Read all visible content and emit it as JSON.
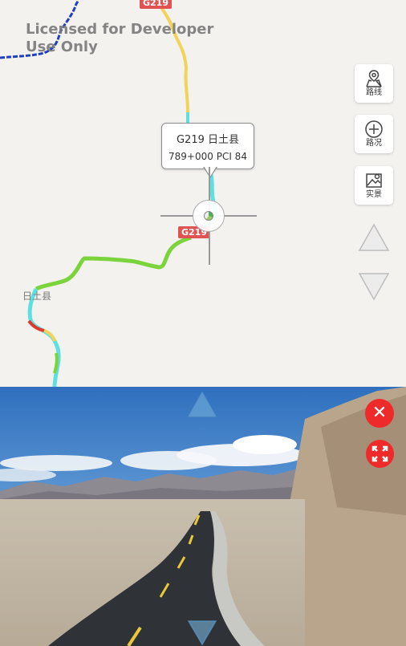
{
  "map": {
    "watermark": "Licensed for Developer Use Only",
    "road_shield_top": "G219",
    "road_shield_mid": "G219",
    "place_label": "日土县",
    "popup": {
      "line1": "G219 日土县",
      "line2": "789+000 PCI 84"
    },
    "buttons": {
      "route_label": "路线",
      "traffic_label": "路况",
      "scene_label": "实景"
    },
    "colors": {
      "route_blue": "#1f3fbf",
      "pci_good": "#7bd43c",
      "pci_cyan": "#5fe0e0",
      "pci_yellow": "#f2d35a",
      "pci_red": "#e0382a",
      "shield_red": "#e15353"
    },
    "icons": [
      "route-map-icon",
      "traffic-plus-icon",
      "scene-image-icon",
      "arrow-up-icon",
      "arrow-down-icon"
    ]
  },
  "photo": {
    "icons": [
      "nav-up-icon",
      "nav-down-icon",
      "close-icon",
      "fullscreen-icon"
    ],
    "close_symbol": "✕",
    "colors": {
      "close_red": "#ef2a2a"
    }
  }
}
